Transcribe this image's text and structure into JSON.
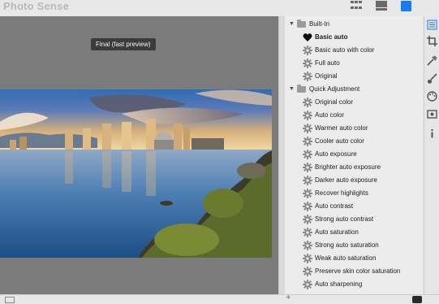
{
  "app": {
    "title": "Photo Sense"
  },
  "toolbar": {
    "icons": [
      "grid-view-icon",
      "single-view-icon",
      "split-view-icon"
    ],
    "accent_color": "#1a7bf0"
  },
  "preview": {
    "tooltip": "Final (fast preview)"
  },
  "presets": {
    "groups": [
      {
        "label": "Built-In",
        "items": [
          {
            "label": "Basic auto",
            "selected": true,
            "icon": "heart-icon"
          },
          {
            "label": "Basic auto with color",
            "icon": "gear-icon"
          },
          {
            "label": "Full auto",
            "icon": "gear-icon"
          },
          {
            "label": "Original",
            "icon": "gear-icon"
          }
        ]
      },
      {
        "label": "Quick Adjustment",
        "items": [
          {
            "label": "Original color",
            "icon": "gear-icon"
          },
          {
            "label": "Auto color",
            "icon": "gear-icon"
          },
          {
            "label": "Warmer auto color",
            "icon": "gear-icon"
          },
          {
            "label": "Cooler auto color",
            "icon": "gear-icon"
          },
          {
            "label": "Auto exposure",
            "icon": "gear-icon"
          },
          {
            "label": "Brighter auto exposure",
            "icon": "gear-icon"
          },
          {
            "label": "Darker auto exposure",
            "icon": "gear-icon"
          },
          {
            "label": "Recover highlights",
            "icon": "gear-icon"
          },
          {
            "label": "Auto contrast",
            "icon": "gear-icon"
          },
          {
            "label": "Strong auto contrast",
            "icon": "gear-icon"
          },
          {
            "label": "Auto saturation",
            "icon": "gear-icon"
          },
          {
            "label": "Strong auto saturation",
            "icon": "gear-icon"
          },
          {
            "label": "Weak auto saturation",
            "icon": "gear-icon"
          },
          {
            "label": "Preserve skin color saturation",
            "icon": "gear-icon"
          },
          {
            "label": "Auto sharpening",
            "icon": "gear-icon"
          }
        ]
      }
    ]
  },
  "tools": [
    "list-icon",
    "crop-icon",
    "tools-icon",
    "brush-icon",
    "palette-icon",
    "film-icon",
    "info-icon"
  ]
}
